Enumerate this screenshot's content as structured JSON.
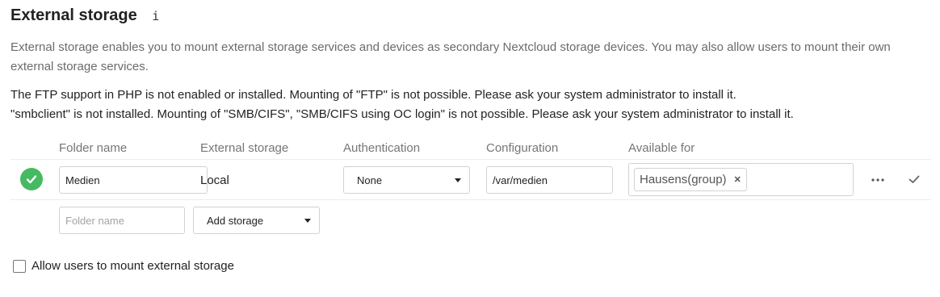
{
  "section": {
    "title": "External storage",
    "info_glyph": "i"
  },
  "description": "External storage enables you to mount external storage services and devices as secondary Nextcloud storage devices. You may also allow users to mount their own external storage services.",
  "warnings": [
    "The FTP support in PHP is not enabled or installed. Mounting of \"FTP\" is not possible. Please ask your system administrator to install it.",
    "\"smbclient\" is not installed. Mounting of \"SMB/CIFS\", \"SMB/CIFS using OC login\" is not possible. Please ask your system administrator to install it."
  ],
  "table": {
    "headers": [
      "Folder name",
      "External storage",
      "Authentication",
      "Configuration",
      "Available for"
    ],
    "rows": [
      {
        "status": "ok",
        "folder_name": "Medien",
        "external_storage": "Local",
        "authentication": "None",
        "configuration": "/var/medien",
        "available_for": [
          "Hausens(group)"
        ],
        "tag_remove_glyph": "✕"
      }
    ],
    "new_row": {
      "folder_placeholder": "Folder name",
      "add_storage_label": "Add storage"
    }
  },
  "allow_users": {
    "label": "Allow users to mount external storage",
    "checked": false
  },
  "colors": {
    "status_ok": "#46ba61",
    "muted_text": "#767676",
    "border": "#d2d2d2"
  },
  "icons": [
    "info-icon",
    "check-circle-icon",
    "dropdown-caret-icon",
    "more-icon",
    "check-icon",
    "remove-tag-icon"
  ]
}
